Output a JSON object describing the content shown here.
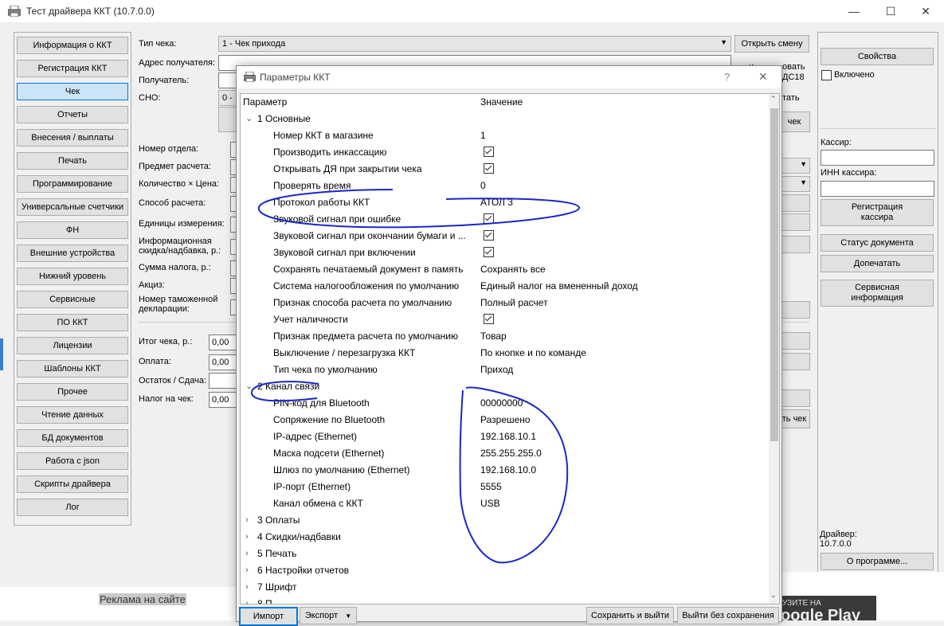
{
  "window": {
    "title": "Тест драйвера ККТ (10.7.0.0)",
    "minimize": "—",
    "maximize": "☐",
    "close": "✕"
  },
  "nav": [
    "Информация о ККТ",
    "Регистрация ККТ",
    "Чек",
    "Отчеты",
    "Внесения / выплаты",
    "Печать",
    "Программирование",
    "Универсальные счетчики",
    "ФН",
    "Внешние устройства",
    "Нижний уровень",
    "Сервисные",
    "ПО ККТ",
    "Лицензии",
    "Шаблоны ККТ",
    "Прочее",
    "Чтение данных",
    "БД документов",
    "Работа с json",
    "Скрипты драйвера",
    "Лог"
  ],
  "form": {
    "receipt_type_label": "Тип чека:",
    "receipt_type_value": "1 - Чек прихода",
    "open_shift": "Открыть смену",
    "recipient_address": "Адрес получателя:",
    "recipient": "Получатель:",
    "sno": "СНО:",
    "sno_value": "0 -",
    "dept": "Номер отдела:",
    "subject": "Предмет расчета:",
    "qty_price": "Количество × Цена:",
    "pay_method": "Способ расчета:",
    "units": "Единицы измерения:",
    "info_discount_1": "Информационная",
    "info_discount_2": "скидка/надбавка, р.:",
    "tax_sum": "Сумма налога, р.:",
    "excise": "Акциз:",
    "customs_1": "Номер таможенной",
    "customs_2": "декларации:",
    "total": "Итог чека, р.:",
    "total_v": "0,00",
    "payment": "Оплата:",
    "payment_v": "0,00",
    "change": "Остаток / Сдача:",
    "tax_on_receipt": "Налог на чек:",
    "tax_v": "0,00",
    "partial_1": "и",
    "partial_2": "овать",
    "partial_3": "ДС18",
    "partial_4": "тать",
    "partial_5": "чек",
    "partial_6": "ть чек"
  },
  "right": {
    "properties": "Свойства",
    "enabled": "Включено",
    "cashier": "Кассир:",
    "cashier_inn": "ИНН кассира:",
    "register_cashier": "Регистрация кассира",
    "doc_status": "Статус документа",
    "reprint": "Допечатать",
    "service_info": "Сервисная информация",
    "driver_label": "Драйвер:",
    "driver_version": "10.7.0.0",
    "about": "О программе..."
  },
  "bottom": {
    "ad": "Реклама на сайте",
    "play_1": "УЗИТЕ НА",
    "play_2": "oogle Play"
  },
  "dialog": {
    "title": "Параметры ККТ",
    "help": "?",
    "close": "✕",
    "col_param": "Параметр",
    "col_value": "Значение",
    "groups": [
      {
        "label": "1 Основные",
        "expanded": true,
        "items": [
          {
            "p": "Номер ККТ в магазине",
            "v": "1"
          },
          {
            "p": "Производить инкассацию",
            "check": true
          },
          {
            "p": "Открывать ДЯ при закрытии чека",
            "check": true
          },
          {
            "p": "Проверять время",
            "v": "0"
          },
          {
            "p": "Протокол работы ККТ",
            "v": "АТОЛ 3"
          },
          {
            "p": "Звуковой сигнал при ошибке",
            "check": true
          },
          {
            "p": "Звуковой сигнал при окончании бумаги и ...",
            "check": true
          },
          {
            "p": "Звуковой сигнал при включении",
            "check": true
          },
          {
            "p": "Сохранять печатаемый документ в память",
            "v": "Сохранять все"
          },
          {
            "p": "Система налогообложения по умолчанию",
            "v": "Единый налог на вмененный доход"
          },
          {
            "p": "Признак способа расчета по умолчанию",
            "v": "Полный расчет"
          },
          {
            "p": "Учет наличности",
            "check": true
          },
          {
            "p": "Признак предмета расчета по умолчанию",
            "v": "Товар"
          },
          {
            "p": "Выключение / перезагрузка ККТ",
            "v": "По кнопке и по команде"
          },
          {
            "p": "Тип чека по умолчанию",
            "v": "Приход"
          }
        ]
      },
      {
        "label": "2 Канал связи",
        "expanded": true,
        "items": [
          {
            "p": "PIN-код для Bluetooth",
            "v": "00000000"
          },
          {
            "p": "Сопряжение по Bluetooth",
            "v": "Разрешено"
          },
          {
            "p": "IP-адрес (Ethernet)",
            "v": "192.168.10.1"
          },
          {
            "p": "Маска подсети (Ethernet)",
            "v": "255.255.255.0"
          },
          {
            "p": "Шлюз по умолчанию (Ethernet)",
            "v": "192.168.10.0"
          },
          {
            "p": "IP-порт (Ethernet)",
            "v": "5555"
          },
          {
            "p": "Канал обмена с ККТ",
            "v": "USB"
          }
        ]
      },
      {
        "label": "3 Оплаты",
        "expanded": false,
        "items": []
      },
      {
        "label": "4 Скидки/надбавки",
        "expanded": false,
        "items": []
      },
      {
        "label": "5 Печать",
        "expanded": false,
        "items": []
      },
      {
        "label": "6 Настройки отчетов",
        "expanded": false,
        "items": []
      },
      {
        "label": "7 Шрифт",
        "expanded": false,
        "items": []
      },
      {
        "label": "8 П...",
        "expanded": false,
        "items": []
      }
    ],
    "import": "Импорт",
    "export": "Экспорт",
    "save_exit": "Сохранить и выйти",
    "exit_nosave": "Выйти без сохранения"
  }
}
